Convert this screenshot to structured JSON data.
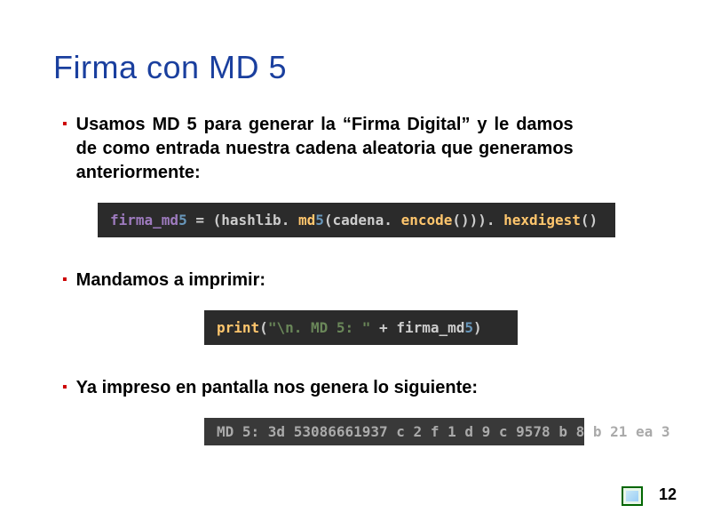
{
  "title": "Firma con MD 5",
  "bullets": {
    "b1": "Usamos MD 5 para generar la “Firma Digital” y le damos de como entrada nuestra cadena aleatoria que generamos anteriormente:",
    "b2": "Mandamos a imprimir:",
    "b3": "Ya impreso en pantalla nos genera lo siguiente:"
  },
  "code": {
    "c1": {
      "var": "firma_md",
      "num1": "5",
      "assign": " = ",
      "p1": "(",
      "mod": "hashlib",
      "dot1": ". ",
      "fn1": "md",
      "num2": "5",
      "p2": "(",
      "arg": "cadena",
      "dot2": ". ",
      "enc": "encode",
      "p3": "()))",
      "dot3": ". ",
      "hex": "hexdigest",
      "p4": "()"
    },
    "c2": {
      "print": "print",
      "p1": "(",
      "str": "\"\\n. MD 5: \"",
      "plus": " + ",
      "var": "firma_md",
      "num": "5",
      "p2": ")"
    }
  },
  "output": "MD 5: 3d 53086661937 c 2 f 1 d 9 c 9578 b 8 b 21 ea 3",
  "page_number": "12"
}
